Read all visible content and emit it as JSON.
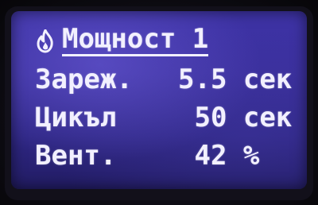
{
  "screen": {
    "title": "Мощност 1",
    "title_icon": "flame-icon",
    "rows": [
      {
        "label": "Зареж.",
        "value": "5.5 сек"
      },
      {
        "label": "Цикъл",
        "value": " 50 сек"
      },
      {
        "label": "Вент.",
        "value": " 42 %"
      }
    ]
  },
  "colors": {
    "lcd_background": "#3a2f9c",
    "text": "#f2f0ff"
  }
}
